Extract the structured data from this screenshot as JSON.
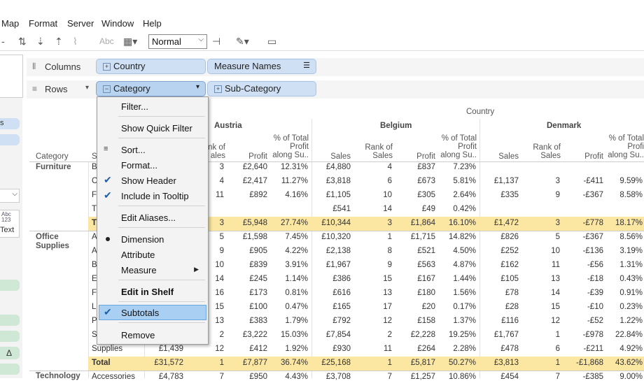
{
  "menubar": [
    "Map",
    "Format",
    "Server",
    "Window",
    "Help"
  ],
  "toolbar": {
    "mark_size": "Normal",
    "abc": "Abc"
  },
  "left_panel": {
    "card_top": "Abc",
    "card_mid": "123",
    "card_text": "Text",
    "delta": "Δ"
  },
  "shelves": {
    "columns_label": "Columns",
    "rows_label": "Rows",
    "columns_pills": [
      "Country",
      "Measure Names"
    ],
    "rows_pills": [
      "Category",
      "Sub-Category"
    ]
  },
  "context_menu": {
    "items": [
      {
        "label": "Filter...",
        "mark": ""
      },
      {
        "label": "Show Quick Filter",
        "mark": ""
      },
      {
        "label": "Sort...",
        "mark": "sort"
      },
      {
        "label": "Format...",
        "mark": ""
      },
      {
        "label": "Show Header",
        "mark": "check"
      },
      {
        "label": "Include in Tooltip",
        "mark": "check"
      },
      {
        "label": "Edit Aliases...",
        "mark": ""
      },
      {
        "label": "Dimension",
        "mark": "dot"
      },
      {
        "label": "Attribute",
        "mark": ""
      },
      {
        "label": "Measure",
        "mark": "submenu"
      },
      {
        "label": "Edit in Shelf",
        "mark": "bold"
      },
      {
        "label": "Subtotals",
        "mark": "check"
      },
      {
        "label": "Remove",
        "mark": ""
      }
    ]
  },
  "table": {
    "country_header": "Country",
    "countries": [
      "Austria",
      "Belgium",
      "Denmark"
    ],
    "row_header": "Category",
    "col_headers": {
      "rank_partial": "ank of\nales",
      "sales": "Sales",
      "rank": "Rank of\nSales",
      "profit": "Profit",
      "pct": "% of Total\nProfit\nalong Su..",
      "pct_right": "% of Total\nProfi\nalong Su.."
    },
    "categories": [
      "Furniture",
      "Office\nSupplies",
      "Technology"
    ],
    "rows": [
      {
        "sub": "B",
        "a_sales": "",
        "a_rank": "3",
        "a_profit": "£2,640",
        "a_pct": "12.31%",
        "b_sales": "£4,880",
        "b_rank": "4",
        "b_profit": "£837",
        "b_pct": "7.23%",
        "d_sales": "",
        "d_rank": "",
        "d_profit": "",
        "d_pct": ""
      },
      {
        "sub": "C",
        "a_sales": "",
        "a_rank": "4",
        "a_profit": "£2,417",
        "a_pct": "11.27%",
        "b_sales": "£3,818",
        "b_rank": "6",
        "b_profit": "£673",
        "b_pct": "5.81%",
        "d_sales": "£1,137",
        "d_rank": "3",
        "d_profit": "-£411",
        "d_pct": "9.59%"
      },
      {
        "sub": "F",
        "a_sales": "",
        "a_rank": "11",
        "a_profit": "£892",
        "a_pct": "4.16%",
        "b_sales": "£1,105",
        "b_rank": "10",
        "b_profit": "£305",
        "b_pct": "2.64%",
        "d_sales": "£335",
        "d_rank": "9",
        "d_profit": "-£367",
        "d_pct": "8.58%"
      },
      {
        "sub": "T",
        "a_sales": "",
        "a_rank": "",
        "a_profit": "",
        "a_pct": "",
        "b_sales": "£541",
        "b_rank": "14",
        "b_profit": "£49",
        "b_pct": "0.42%",
        "d_sales": "",
        "d_rank": "",
        "d_profit": "",
        "d_pct": ""
      },
      {
        "sub": "T",
        "total": true,
        "a_sales": "",
        "a_rank": "3",
        "a_profit": "£5,948",
        "a_pct": "27.74%",
        "b_sales": "£10,344",
        "b_rank": "3",
        "b_profit": "£1,864",
        "b_pct": "16.10%",
        "d_sales": "£1,472",
        "d_rank": "3",
        "d_profit": "-£778",
        "d_pct": "18.17%"
      },
      {
        "sub": "A",
        "a_sales": "",
        "a_rank": "5",
        "a_profit": "£1,598",
        "a_pct": "7.45%",
        "b_sales": "£10,320",
        "b_rank": "1",
        "b_profit": "£1,715",
        "b_pct": "14.82%",
        "d_sales": "£826",
        "d_rank": "5",
        "d_profit": "-£367",
        "d_pct": "8.56%"
      },
      {
        "sub": "A",
        "a_sales": "",
        "a_rank": "9",
        "a_profit": "£905",
        "a_pct": "4.22%",
        "b_sales": "£2,138",
        "b_rank": "8",
        "b_profit": "£521",
        "b_pct": "4.50%",
        "d_sales": "£252",
        "d_rank": "10",
        "d_profit": "-£136",
        "d_pct": "3.19%"
      },
      {
        "sub": "B",
        "a_sales": "",
        "a_rank": "10",
        "a_profit": "£839",
        "a_pct": "3.91%",
        "b_sales": "£1,967",
        "b_rank": "9",
        "b_profit": "£563",
        "b_pct": "4.87%",
        "d_sales": "£162",
        "d_rank": "11",
        "d_profit": "-£56",
        "d_pct": "1.31%"
      },
      {
        "sub": "E",
        "a_sales": "",
        "a_rank": "14",
        "a_profit": "£245",
        "a_pct": "1.14%",
        "b_sales": "£386",
        "b_rank": "15",
        "b_profit": "£167",
        "b_pct": "1.44%",
        "d_sales": "£105",
        "d_rank": "13",
        "d_profit": "-£18",
        "d_pct": "0.43%"
      },
      {
        "sub": "F",
        "a_sales": "",
        "a_rank": "16",
        "a_profit": "£173",
        "a_pct": "0.81%",
        "b_sales": "£616",
        "b_rank": "13",
        "b_profit": "£180",
        "b_pct": "1.56%",
        "d_sales": "£78",
        "d_rank": "14",
        "d_profit": "-£39",
        "d_pct": "0.91%"
      },
      {
        "sub": "L",
        "a_sales": "",
        "a_rank": "15",
        "a_profit": "£100",
        "a_pct": "0.47%",
        "b_sales": "£165",
        "b_rank": "17",
        "b_profit": "£20",
        "b_pct": "0.17%",
        "d_sales": "£28",
        "d_rank": "15",
        "d_profit": "-£10",
        "d_pct": "0.23%"
      },
      {
        "sub": "P",
        "a_sales": "",
        "a_rank": "13",
        "a_profit": "£383",
        "a_pct": "1.79%",
        "b_sales": "£792",
        "b_rank": "12",
        "b_profit": "£158",
        "b_pct": "1.37%",
        "d_sales": "£116",
        "d_rank": "12",
        "d_profit": "-£52",
        "d_pct": "1.22%"
      },
      {
        "sub": "S",
        "a_sales": "",
        "a_rank": "2",
        "a_profit": "£3,222",
        "a_pct": "15.03%",
        "b_sales": "£7,854",
        "b_rank": "2",
        "b_profit": "£2,228",
        "b_pct": "19.25%",
        "d_sales": "£1,767",
        "d_rank": "1",
        "d_profit": "-£978",
        "d_pct": "22.84%"
      },
      {
        "sub": "Supplies",
        "a_sales": "£1,439",
        "a_rank": "12",
        "a_profit": "£412",
        "a_pct": "1.92%",
        "b_sales": "£930",
        "b_rank": "11",
        "b_profit": "£264",
        "b_pct": "2.28%",
        "d_sales": "£478",
        "d_rank": "6",
        "d_profit": "-£211",
        "d_pct": "4.92%"
      },
      {
        "sub": "Total",
        "total": true,
        "a_sales": "£31,572",
        "a_rank": "1",
        "a_profit": "£7,877",
        "a_pct": "36.74%",
        "b_sales": "£25,168",
        "b_rank": "1",
        "b_profit": "£5,817",
        "b_pct": "50.27%",
        "d_sales": "£3,813",
        "d_rank": "1",
        "d_profit": "-£1,868",
        "d_pct": "43.62%"
      },
      {
        "sub": "Accessories",
        "a_sales": "£4,783",
        "a_rank": "7",
        "a_profit": "£950",
        "a_pct": "4.43%",
        "b_sales": "£3,708",
        "b_rank": "7",
        "b_profit": "£1,257",
        "b_pct": "10.86%",
        "d_sales": "£454",
        "d_rank": "7",
        "d_profit": "-£385",
        "d_pct": "9.00%"
      }
    ]
  },
  "colors": {
    "total_band": "#fbe7a2",
    "pill": "#cfe0f4",
    "highlight": "#a9cff3"
  }
}
